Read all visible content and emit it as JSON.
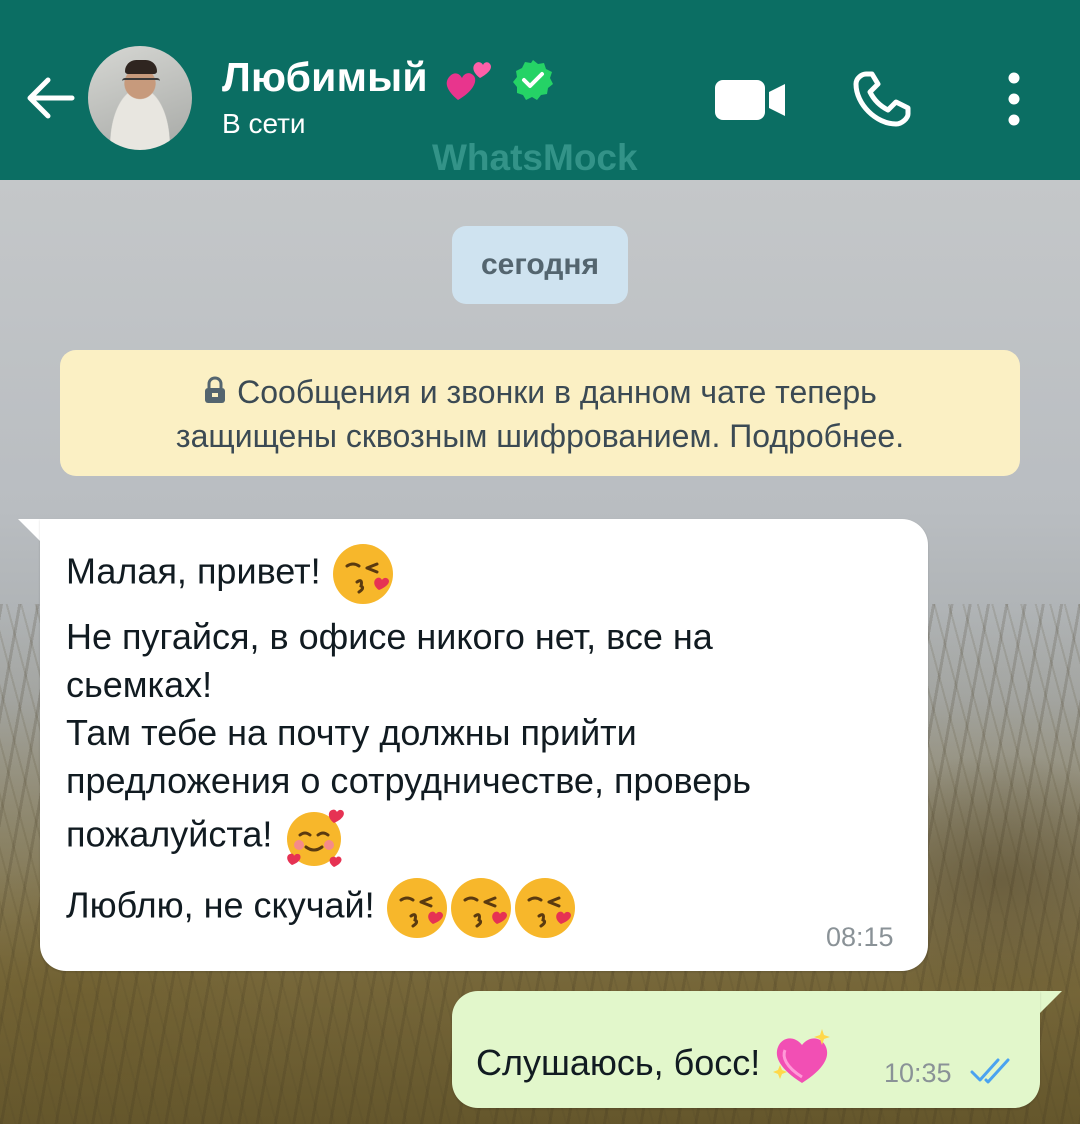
{
  "header": {
    "contact_name": "Любимый",
    "status": "В сети",
    "watermark": "WhatsMock",
    "icons": [
      "back-arrow-icon",
      "avatar",
      "two-hearts-icon",
      "verified-badge-icon",
      "video-call-icon",
      "voice-call-icon",
      "more-options-icon"
    ],
    "colors": {
      "bar": "#0b6e63",
      "verified": "#25d366"
    }
  },
  "chat": {
    "date_chip": "сегодня",
    "encryption_notice": {
      "line1": "Сообщения и звонки в данном чате теперь",
      "line2": "защищены сквозным шифрованием. Подробнее."
    },
    "incoming": {
      "lines": [
        "Малая, привет!",
        "Не пугайся, в офисе никого нет, все на",
        "сьемках!",
        "Там тебе на почту должны прийти",
        "предложения о сотрудничестве, проверь",
        "пожалуйста!",
        "Люблю, не скучай!"
      ],
      "emojis": [
        "kissing-heart-emoji",
        "smiling-hearts-emoji",
        "kissing-heart-emoji",
        "kissing-heart-emoji",
        "kissing-heart-emoji"
      ],
      "time": "08:15"
    },
    "outgoing": {
      "text": "Слушаюсь, босс!",
      "emoji": "sparkling-heart-emoji",
      "time": "10:35",
      "status_icon": "double-check-read-icon"
    }
  }
}
